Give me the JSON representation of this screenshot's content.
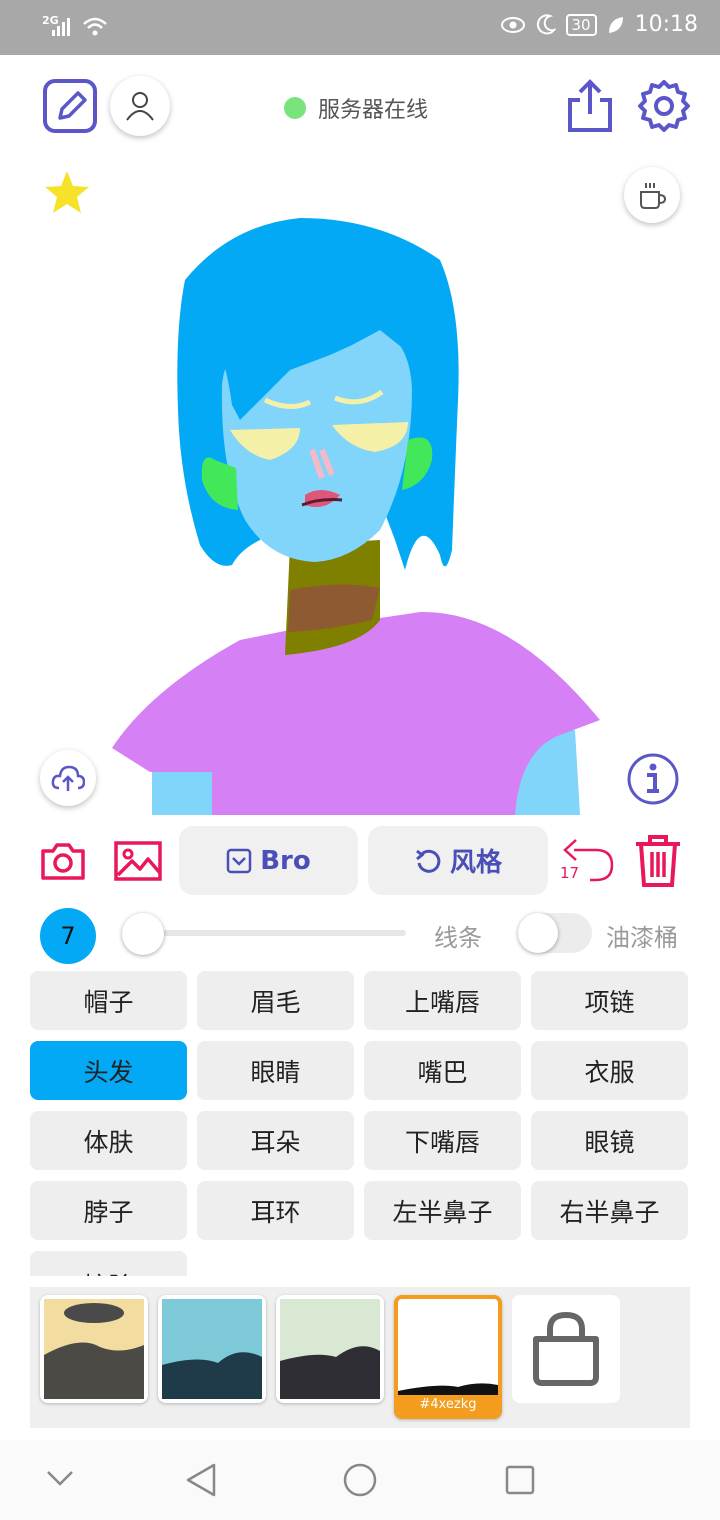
{
  "status_bar": {
    "signal": "2G",
    "battery": "30",
    "time": "10:18"
  },
  "toolbar": {
    "edit_icon": "edit-icon",
    "profile_icon": "user-icon",
    "server_status": "服务器在线",
    "server_status_color": "#7be37e",
    "share_icon": "share-icon",
    "settings_icon": "gear-icon",
    "accent": "#5b57c9"
  },
  "canvas": {
    "favorite_icon": "star-icon",
    "coffee_icon": "coffee-icon",
    "upload_icon": "cloud-upload-icon",
    "info_icon": "info-icon"
  },
  "actions": {
    "camera_icon": "camera-icon",
    "gallery_icon": "image-icon",
    "mode_label": "Bro",
    "style_label": "风格",
    "undo_count": "17",
    "delete_icon": "trash-icon",
    "accent_red": "#e8185a"
  },
  "brush": {
    "size": "7",
    "mode_label": "线条",
    "bucket_label": "油漆桶"
  },
  "parts": {
    "items": [
      {
        "label": "帽子"
      },
      {
        "label": "眉毛"
      },
      {
        "label": "上嘴唇"
      },
      {
        "label": "项链"
      },
      {
        "label": "头发"
      },
      {
        "label": "眼睛"
      },
      {
        "label": "嘴巴"
      },
      {
        "label": "衣服"
      },
      {
        "label": "体肤"
      },
      {
        "label": "耳朵"
      },
      {
        "label": "下嘴唇"
      },
      {
        "label": "眼镜"
      },
      {
        "label": "脖子"
      },
      {
        "label": "耳环"
      },
      {
        "label": "左半鼻子"
      },
      {
        "label": "右半鼻子"
      },
      {
        "label": "擦除"
      }
    ],
    "selected": "头发",
    "selected_color": "#03a9f4"
  },
  "styles": {
    "selected_tag": "#4xezkg",
    "shop_icon": "shopping-bag-icon"
  }
}
